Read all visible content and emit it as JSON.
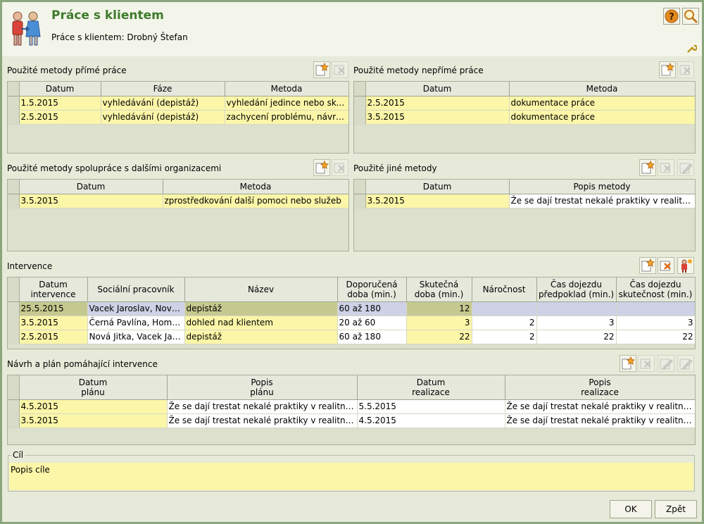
{
  "header": {
    "title": "Práce s klientem",
    "subtitle": "Práce s klientem: Drobný Štefan"
  },
  "sections": {
    "direct": {
      "title": "Použité metody přímé práce",
      "columns": [
        "Datum",
        "Fáze",
        "Metoda"
      ],
      "rows": [
        [
          "1.5.2015",
          "vyhledávání (depistáž)",
          "vyhledání jedince nebo skupiny"
        ],
        [
          "2.5.2015",
          "vyhledávání (depistáž)",
          "zachycení problému, návrh intervence"
        ]
      ]
    },
    "indirect": {
      "title": "Použité metody nepřímé práce",
      "columns": [
        "Datum",
        "Metoda"
      ],
      "rows": [
        [
          "2.5.2015",
          "dokumentace práce"
        ],
        [
          "3.5.2015",
          "dokumentace práce"
        ]
      ]
    },
    "cooperation": {
      "title": "Použité metody spolupráce s dalšími organizacemi",
      "columns": [
        "Datum",
        "Metoda"
      ],
      "rows": [
        [
          "3.5.2015",
          "zprostředkování další pomoci nebo služeb"
        ]
      ]
    },
    "other": {
      "title": "Použité jiné metody",
      "columns": [
        "Datum",
        "Popis metody"
      ],
      "rows": [
        [
          "3.5.2015",
          "Že se dají trestat nekalé praktiky v realitním byznysu"
        ]
      ]
    },
    "interventions": {
      "title": "Intervence",
      "columns": [
        {
          "l1": "Datum",
          "l2": "intervence"
        },
        {
          "l1": "Sociální pracovník",
          "l2": ""
        },
        {
          "l1": "Název",
          "l2": ""
        },
        {
          "l1": "Doporučená",
          "l2": "doba (min.)"
        },
        {
          "l1": "Skutečná",
          "l2": "doba (min.)"
        },
        {
          "l1": "Náročnost",
          "l2": ""
        },
        {
          "l1": "Čas dojezdu",
          "l2": "předpoklad (min.)"
        },
        {
          "l1": "Čas dojezdu",
          "l2": "skutečnost (min.)"
        }
      ],
      "rows": [
        [
          "25.5.2015",
          "Vacek Jaroslav, Nová Jitka",
          "depistáž",
          "60 až 180",
          "12",
          "",
          "",
          ""
        ],
        [
          "3.5.2015",
          "Černá Pavlína, Homolková",
          "dohled nad klientem",
          "20 až 60",
          "3",
          "2",
          "3",
          "3"
        ],
        [
          "2.5.2015",
          "Nová Jitka, Vacek Jaroslav",
          "depistáž",
          "60 až 180",
          "22",
          "2",
          "22",
          "22"
        ]
      ]
    },
    "plan": {
      "title": "Návrh a plán pomáhající intervence",
      "columns": [
        {
          "l1": "Datum",
          "l2": "plánu"
        },
        {
          "l1": "Popis",
          "l2": "plánu"
        },
        {
          "l1": "Datum",
          "l2": "realizace"
        },
        {
          "l1": "Popis",
          "l2": "realizace"
        }
      ],
      "rows": [
        [
          "4.5.2015",
          "Že se dají trestat nekalé praktiky v realitním byznysu",
          "5.5.2015",
          "Že se dají trestat nekalé praktiky v realitním byznysu"
        ],
        [
          "3.5.2015",
          "Že se dají trestat nekalé praktiky v realitním byznysu",
          "4.5.2015",
          "Že se dají trestat nekalé praktiky v realitním byznysu"
        ]
      ]
    }
  },
  "goal": {
    "legend": "Cíl",
    "value": "Popis cíle"
  },
  "buttons": {
    "ok": "OK",
    "back": "Zpět"
  },
  "icons": {
    "header": "clients-icon",
    "help": "help-icon",
    "search": "search-icon",
    "settings": "wrench-icon"
  },
  "colors": {
    "title": "#3e7a2c",
    "row_highlight": "#fbf6a8",
    "selected_row": "#c6c98f",
    "window_border": "#8aa67d"
  }
}
